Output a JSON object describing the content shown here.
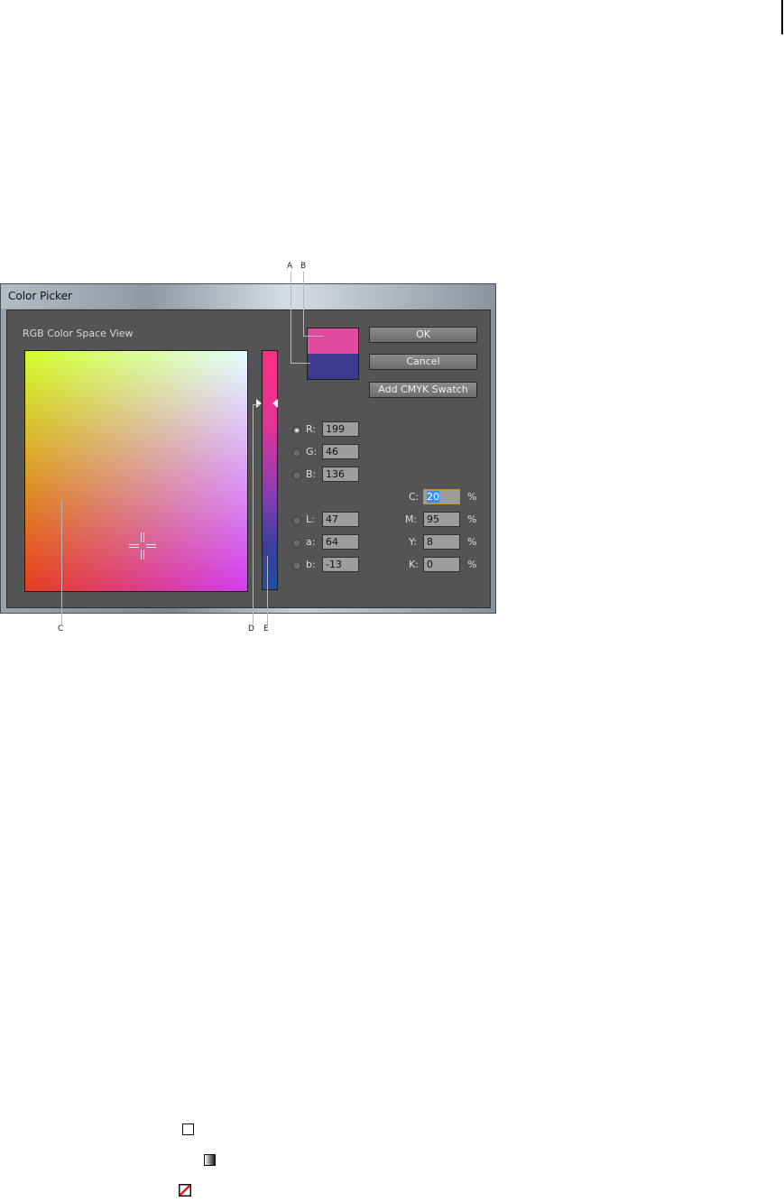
{
  "window": {
    "title": "Color Picker"
  },
  "view": {
    "label": "RGB Color Space View"
  },
  "swatch": {
    "new_color": "#e04aa0",
    "original_color": "#3b3a8e"
  },
  "buttons": {
    "ok": "OK",
    "cancel": "Cancel",
    "add_swatch": "Add CMYK Swatch"
  },
  "rgb": [
    {
      "label": "R:",
      "value": "199",
      "selected": true
    },
    {
      "label": "G:",
      "value": "46",
      "selected": false
    },
    {
      "label": "B:",
      "value": "136",
      "selected": false
    }
  ],
  "lab": [
    {
      "label": "L:",
      "value": "47"
    },
    {
      "label": "a:",
      "value": "64"
    },
    {
      "label": "b:",
      "value": "-13"
    }
  ],
  "cmyk": [
    {
      "label": "C:",
      "value": "20",
      "unit": "%"
    },
    {
      "label": "M:",
      "value": "95",
      "unit": "%"
    },
    {
      "label": "Y:",
      "value": "8",
      "unit": "%"
    },
    {
      "label": "K:",
      "value": "0",
      "unit": "%"
    }
  ],
  "callouts": [
    "A",
    "B",
    "C",
    "D",
    "E"
  ],
  "icons": [
    "stroke-square-icon",
    "gradient-square-icon",
    "none-swatch-icon"
  ]
}
